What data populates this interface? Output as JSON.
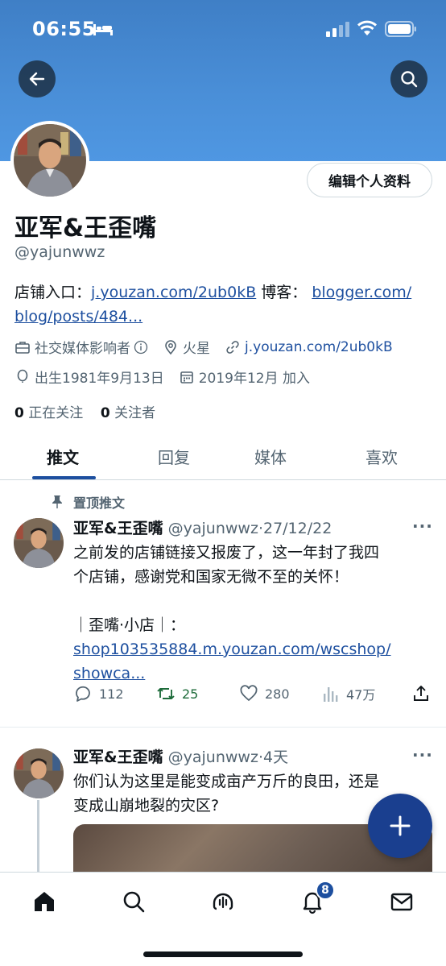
{
  "status_bar": {
    "time": "06:55"
  },
  "profile": {
    "display_name": "亚军&王歪嘴",
    "handle": "@yajunwwz",
    "edit_button": "编辑个人资料",
    "bio": {
      "shop_label": "店铺入口：",
      "shop_link": "j.youzan.com/2ub0kB",
      "blog_label": " 博客：",
      "blog_link_line1": "blogger.com/",
      "blog_link_line2": "blog/posts/484..."
    },
    "category": "社交媒体影响者",
    "location": "火星",
    "website": "j.youzan.com/2ub0kB",
    "birthday": "出生1981年9月13日",
    "joined": "2019年12月 加入",
    "following_count": "0",
    "following_label": "正在关注",
    "followers_count": "0",
    "followers_label": "关注者"
  },
  "tabs": [
    {
      "label": "推文",
      "active": true
    },
    {
      "label": "回复",
      "active": false
    },
    {
      "label": "媒体",
      "active": false
    },
    {
      "label": "喜欢",
      "active": false
    }
  ],
  "tweets": [
    {
      "pinned_label": "置顶推文",
      "name": "亚军&王歪嘴",
      "handle": "@yajunwwz",
      "time": "·27/12/22",
      "text_line1": "之前发的店铺链接又报废了，这一年封了我四",
      "text_line2": "个店铺，感谢党和国家无微不至的关怀！",
      "text_line3": "｜歪嘴·小店｜：",
      "link_line1": "shop103535884.m.youzan.com/wscshop/",
      "link_line2": "showca...",
      "replies": "112",
      "retweets": "25",
      "likes": "280",
      "views": "47万"
    },
    {
      "name": "亚军&王歪嘴",
      "handle": "@yajunwwz",
      "time": "·4天",
      "text_line1": "你们认为这里是能变成亩产万斤的良田，还是",
      "text_line2": "变成山崩地裂的灾区?"
    }
  ],
  "nav": {
    "notifications_badge": "8"
  },
  "colors": {
    "accent": "#1d4f9f",
    "banner": "#4a8fd8",
    "retweet": "#1d6b3a"
  }
}
